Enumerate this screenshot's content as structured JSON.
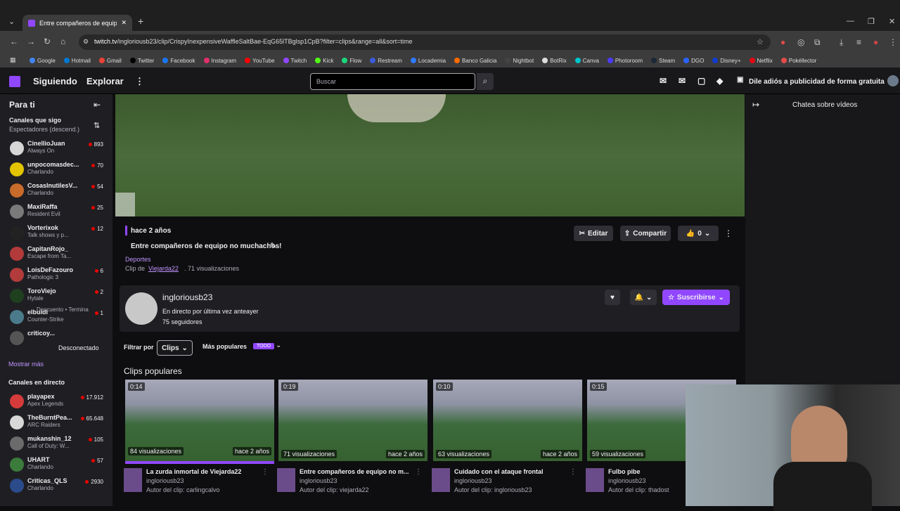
{
  "browser": {
    "tab_title": "Entre compañeros de equipo n",
    "url_domain": "twitch.tv",
    "url_rest": "/ingloriousb23/clip/CrispyInexpensiveWaffleSaltBae-EqG65lTBglsp1CpB?filter=clips&range=all&sort=time",
    "bookmarks": [
      {
        "label": "Google",
        "color": "#4285f4"
      },
      {
        "label": "Hotmail",
        "color": "#0078d4"
      },
      {
        "label": "Gmail",
        "color": "#ea4335"
      },
      {
        "label": "Twitter",
        "color": "#000000"
      },
      {
        "label": "Facebook",
        "color": "#1877f2"
      },
      {
        "label": "Instagram",
        "color": "#e1306c"
      },
      {
        "label": "YouTube",
        "color": "#ff0000"
      },
      {
        "label": "Twitch",
        "color": "#9147ff"
      },
      {
        "label": "Kick",
        "color": "#53fc18"
      },
      {
        "label": "Flow",
        "color": "#1bd77b"
      },
      {
        "label": "Restream",
        "color": "#3b5bdb"
      },
      {
        "label": "Locademia",
        "color": "#2f7bff"
      },
      {
        "label": "Banco Galicia",
        "color": "#ff6b00"
      },
      {
        "label": "Nightbot",
        "color": "#444444"
      },
      {
        "label": "BotRix",
        "color": "#dddddd"
      },
      {
        "label": "Canva",
        "color": "#00c4cc"
      },
      {
        "label": "Photoroom",
        "color": "#4b3bff"
      },
      {
        "label": "Steam",
        "color": "#1b2838"
      },
      {
        "label": "DGO",
        "color": "#2a63ff"
      },
      {
        "label": "Disney+",
        "color": "#113ccf"
      },
      {
        "label": "Netflix",
        "color": "#e50914"
      },
      {
        "label": "Pokéllector",
        "color": "#e34b4b"
      }
    ]
  },
  "twitch_nav": {
    "following": "Siguiendo",
    "explore": "Explorar",
    "search_placeholder": "Buscar",
    "ad_free": "Dile adiós a publicidad de forma gratuita"
  },
  "sidebar": {
    "for_you": "Para ti",
    "followed_header": "Canales que sigo",
    "followed_sort": "Espectadores (descend.)",
    "followed": [
      {
        "name": "CinellioJuan",
        "sub": "Always On",
        "viewers": "893",
        "color": "#d6d6d6"
      },
      {
        "name": "unpocomasdec...",
        "sub": "Charlando",
        "viewers": "70",
        "color": "#e2c400"
      },
      {
        "name": "CosasInutilesV...",
        "sub": "Charlando",
        "viewers": "54",
        "color": "#c96b2b"
      },
      {
        "name": "MaxiRaffa",
        "sub": "Resident Evil",
        "viewers": "25",
        "color": "#7a7a7a"
      },
      {
        "name": "Vorterixok",
        "sub": "Talk shows y p...",
        "viewers": "12",
        "color": "#222222"
      },
      {
        "name": "CapitanRojo_",
        "sub": "Escape from Ta...",
        "viewers": "",
        "color": "#b33a3a"
      },
      {
        "name": "LoisDeFazouro",
        "sub": "Pathologic 3",
        "viewers": "6",
        "color": "#b23b3b"
      },
      {
        "name": "ToroViejo",
        "sub": "Hytale",
        "viewers": "2",
        "color": "#1f3f1f"
      },
      {
        "name": "elbuldi",
        "sub": "Counter-Strike",
        "viewers": "1",
        "color": "#4b7b8b"
      },
      {
        "name": "criticoy...",
        "sub": "",
        "viewers": "",
        "color": "#555555"
      }
    ],
    "discount": "Descuento • Termina",
    "offline": "Desconectado",
    "show_more": "Mostrar más",
    "live_header": "Canales en directo",
    "live": [
      {
        "name": "playapex",
        "sub": "Apex Legends",
        "viewers": "17.912",
        "color": "#d63b3b"
      },
      {
        "name": "TheBurntPea...",
        "sub": "ARC Raiders",
        "viewers": "65.648",
        "color": "#d8d8d8"
      },
      {
        "name": "mukanshin_12",
        "sub": "Call of Duty: W...",
        "viewers": "105",
        "color": "#6b6b6b"
      },
      {
        "name": "UHART",
        "sub": "Charlando",
        "viewers": "57",
        "color": "#3b7b3b"
      },
      {
        "name": "Criticas_QLS",
        "sub": "Charlando",
        "viewers": "2930",
        "color": "#2b4b8b"
      }
    ]
  },
  "clip": {
    "ago": "hace 2 años",
    "title": "Entre compañeros de equipo no muchachos!",
    "category": "Deportes",
    "clip_by_prefix": "Clip de",
    "clip_author": "Viejarda22",
    "views": ". 71 visualizaciones",
    "edit": "Editar",
    "share": "Compartir",
    "likes": "0"
  },
  "channel": {
    "name": "ingloriousb23",
    "last_live": "En directo por última vez anteayer",
    "followers": "75 seguidores",
    "subscribe": "Suscribirse"
  },
  "filter": {
    "label": "Filtrar por",
    "type": "Clips",
    "sort": "Más populares",
    "badge": "TODO"
  },
  "clips_header": "Clips populares",
  "clips": [
    {
      "duration": "0:14",
      "views": "84 visualizaciones",
      "ago": "hace 2 años",
      "title": "La zurda inmortal de Viejarda22",
      "channel": "ingloriousb23",
      "author": "Autor del clip: carlingcalvo"
    },
    {
      "duration": "0:19",
      "views": "71 visualizaciones",
      "ago": "hace 2 años",
      "title": "Entre compañeros de equipo no m...",
      "channel": "ingloriousb23",
      "author": "Autor del clip: viejarda22"
    },
    {
      "duration": "0:10",
      "views": "63 visualizaciones",
      "ago": "hace 2 años",
      "title": "Cuidado con el ataque frontal",
      "channel": "ingloriousb23",
      "author": "Autor del clip: ingloriousb23"
    },
    {
      "duration": "0:15",
      "views": "59 visualizaciones",
      "ago": "",
      "title": "Fulbo pibe",
      "channel": "ingloriousb23",
      "author": "Autor del clip: thadost"
    }
  ],
  "chat": {
    "label": "Chatea sobre vídeos"
  }
}
